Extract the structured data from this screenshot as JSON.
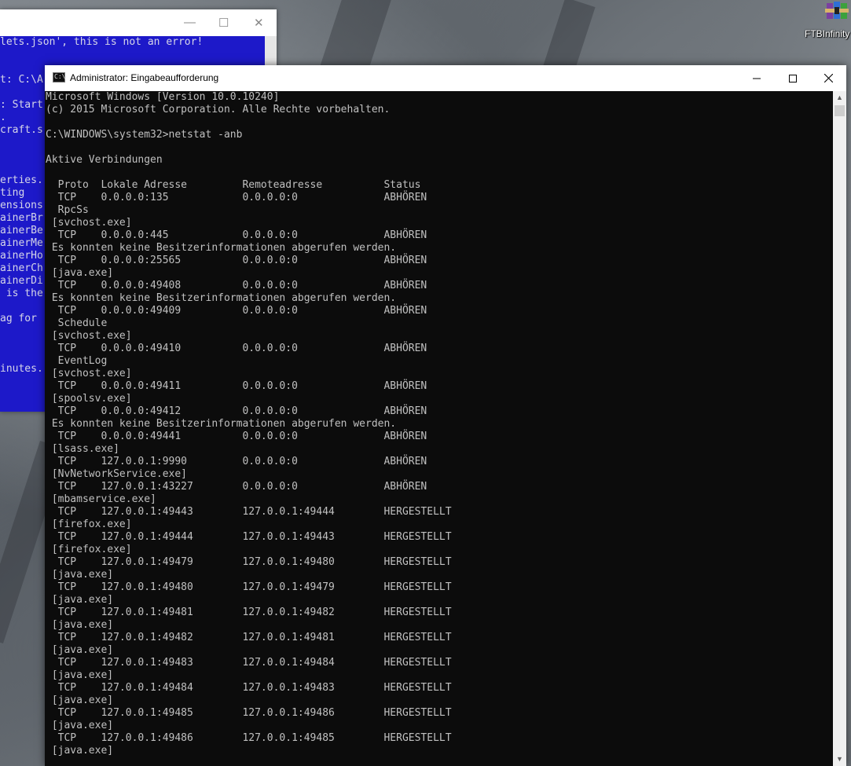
{
  "desktop": {
    "icon_name": "winrar-archive-icon",
    "icon_label": "FTBInfinity"
  },
  "background_window": {
    "lines": [
      "lets.json', this is not an error!",
      "",
      "",
      "t: C:\\A",
      "",
      ": Start",
      ".",
      "craft.s",
      "",
      "",
      "",
      "erties.",
      "ting",
      "ensions",
      "ainerBr",
      "ainerBe",
      "ainerMe",
      "ainerHo",
      "ainerCh",
      "ainerDi",
      " is the",
      "",
      "ag for",
      "",
      "",
      "",
      "inutes."
    ]
  },
  "cmd_window": {
    "title": "Administrator: Eingabeaufforderung",
    "icon_text": "C:\\",
    "lines": [
      "Microsoft Windows [Version 10.0.10240]",
      "(c) 2015 Microsoft Corporation. Alle Rechte vorbehalten.",
      "",
      "C:\\WINDOWS\\system32>netstat -anb",
      "",
      "Aktive Verbindungen",
      "",
      "  Proto  Lokale Adresse         Remoteadresse          Status",
      "  TCP    0.0.0.0:135            0.0.0.0:0              ABHÖREN",
      "  RpcSs",
      " [svchost.exe]",
      "  TCP    0.0.0.0:445            0.0.0.0:0              ABHÖREN",
      " Es konnten keine Besitzerinformationen abgerufen werden.",
      "  TCP    0.0.0.0:25565          0.0.0.0:0              ABHÖREN",
      " [java.exe]",
      "  TCP    0.0.0.0:49408          0.0.0.0:0              ABHÖREN",
      " Es konnten keine Besitzerinformationen abgerufen werden.",
      "  TCP    0.0.0.0:49409          0.0.0.0:0              ABHÖREN",
      "  Schedule",
      " [svchost.exe]",
      "  TCP    0.0.0.0:49410          0.0.0.0:0              ABHÖREN",
      "  EventLog",
      " [svchost.exe]",
      "  TCP    0.0.0.0:49411          0.0.0.0:0              ABHÖREN",
      " [spoolsv.exe]",
      "  TCP    0.0.0.0:49412          0.0.0.0:0              ABHÖREN",
      " Es konnten keine Besitzerinformationen abgerufen werden.",
      "  TCP    0.0.0.0:49441          0.0.0.0:0              ABHÖREN",
      " [lsass.exe]",
      "  TCP    127.0.0.1:9990         0.0.0.0:0              ABHÖREN",
      " [NvNetworkService.exe]",
      "  TCP    127.0.0.1:43227        0.0.0.0:0              ABHÖREN",
      " [mbamservice.exe]",
      "  TCP    127.0.0.1:49443        127.0.0.1:49444        HERGESTELLT",
      " [firefox.exe]",
      "  TCP    127.0.0.1:49444        127.0.0.1:49443        HERGESTELLT",
      " [firefox.exe]",
      "  TCP    127.0.0.1:49479        127.0.0.1:49480        HERGESTELLT",
      " [java.exe]",
      "  TCP    127.0.0.1:49480        127.0.0.1:49479        HERGESTELLT",
      " [java.exe]",
      "  TCP    127.0.0.1:49481        127.0.0.1:49482        HERGESTELLT",
      " [java.exe]",
      "  TCP    127.0.0.1:49482        127.0.0.1:49481        HERGESTELLT",
      " [java.exe]",
      "  TCP    127.0.0.1:49483        127.0.0.1:49484        HERGESTELLT",
      " [java.exe]",
      "  TCP    127.0.0.1:49484        127.0.0.1:49483        HERGESTELLT",
      " [java.exe]",
      "  TCP    127.0.0.1:49485        127.0.0.1:49486        HERGESTELLT",
      " [java.exe]",
      "  TCP    127.0.0.1:49486        127.0.0.1:49485        HERGESTELLT",
      " [java.exe]"
    ]
  }
}
